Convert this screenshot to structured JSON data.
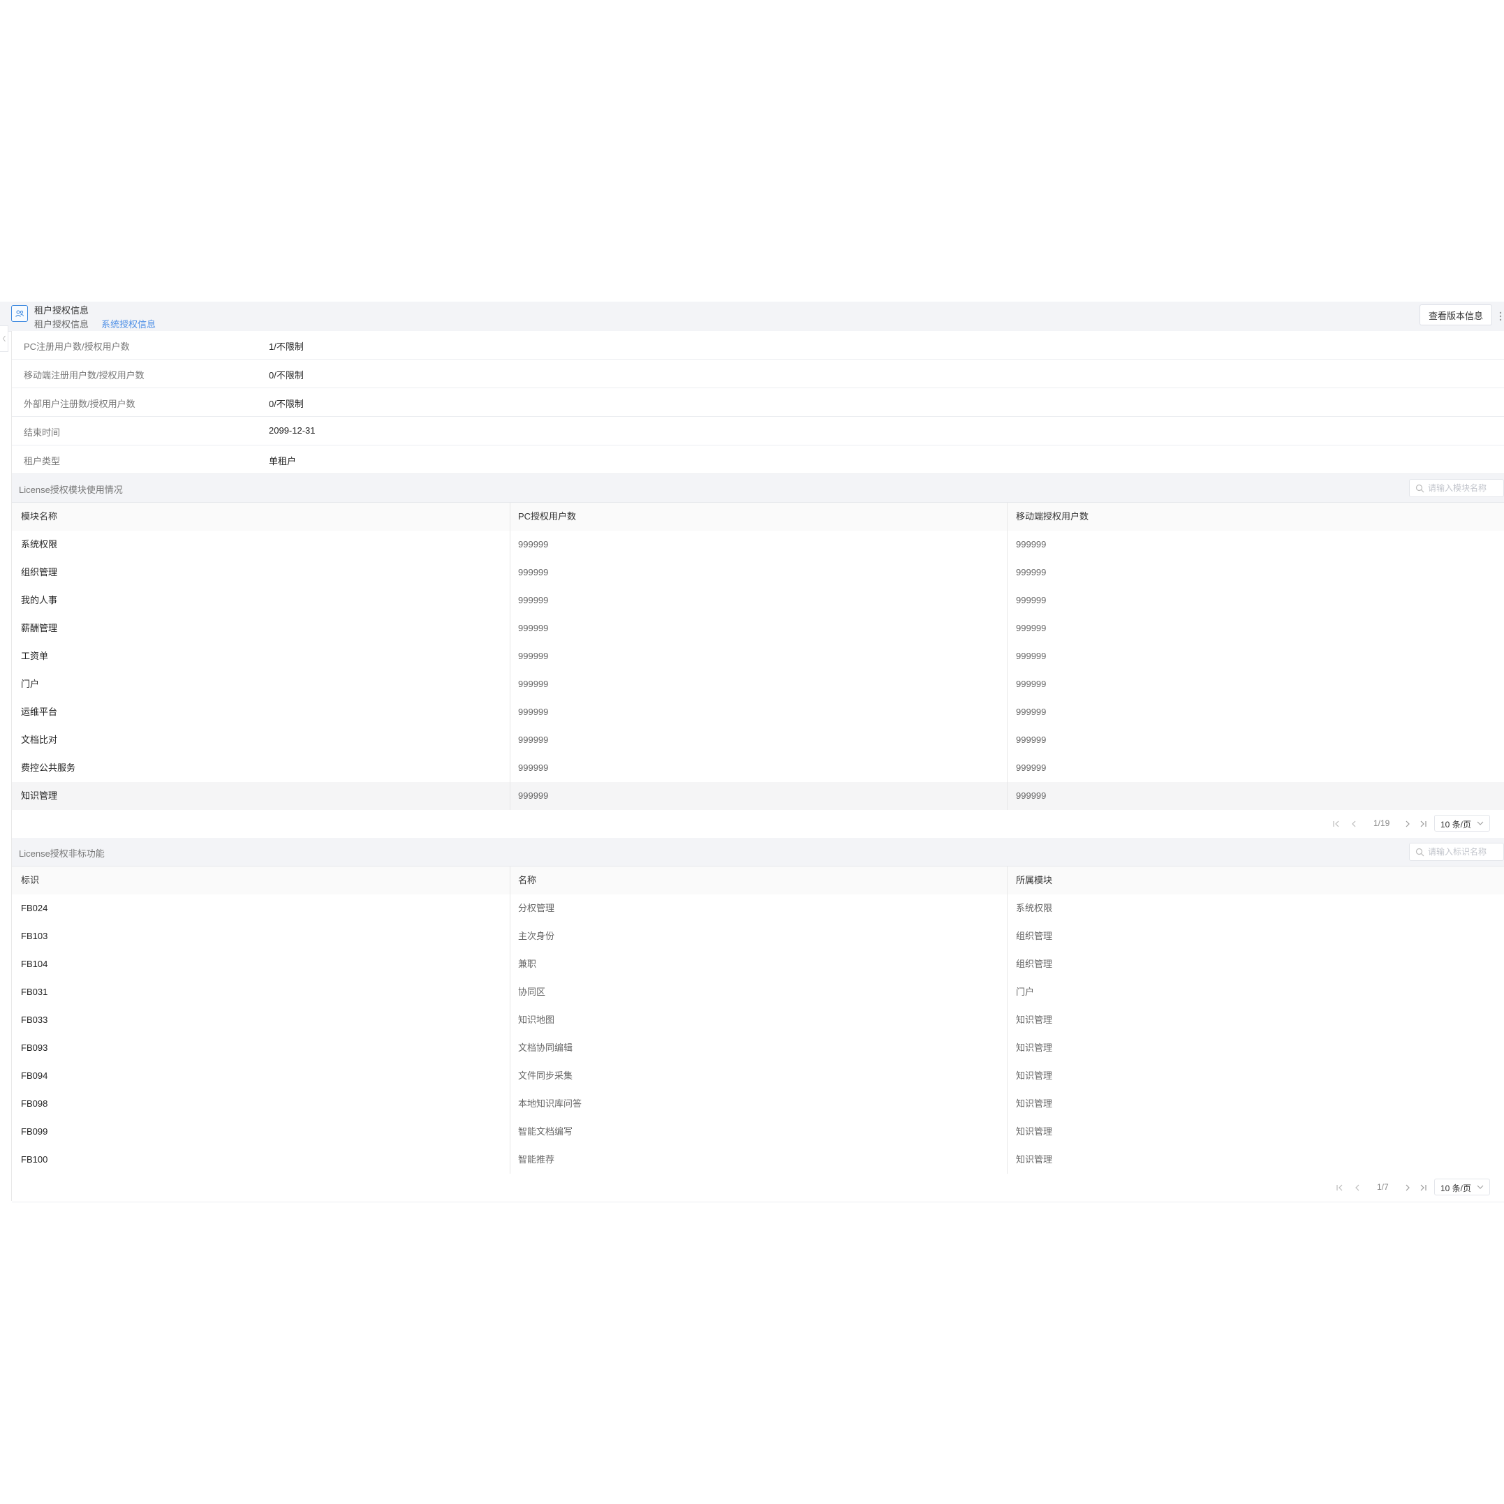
{
  "header": {
    "title": "租户授权信息",
    "tabs": [
      {
        "label": "租户授权信息",
        "active": false
      },
      {
        "label": "系统授权信息",
        "active": true
      }
    ],
    "version_button": "查看版本信息"
  },
  "info_rows": [
    {
      "label": "PC注册用户数/授权用户数",
      "value": "1/不限制"
    },
    {
      "label": "移动端注册用户数/授权用户数",
      "value": "0/不限制"
    },
    {
      "label": "外部用户注册数/授权用户数",
      "value": "0/不限制"
    },
    {
      "label": "结束时间",
      "value": "2099-12-31"
    },
    {
      "label": "租户类型",
      "value": "单租户"
    }
  ],
  "modules_section": {
    "title": "License授权模块使用情况",
    "search_placeholder": "请输入模块名称",
    "columns": [
      "模块名称",
      "PC授权用户数",
      "移动端授权用户数"
    ],
    "rows": [
      [
        "系统权限",
        "999999",
        "999999"
      ],
      [
        "组织管理",
        "999999",
        "999999"
      ],
      [
        "我的人事",
        "999999",
        "999999"
      ],
      [
        "薪酬管理",
        "999999",
        "999999"
      ],
      [
        "工资单",
        "999999",
        "999999"
      ],
      [
        "门户",
        "999999",
        "999999"
      ],
      [
        "运维平台",
        "999999",
        "999999"
      ],
      [
        "文档比对",
        "999999",
        "999999"
      ],
      [
        "费控公共服务",
        "999999",
        "999999"
      ],
      [
        "知识管理",
        "999999",
        "999999"
      ]
    ],
    "pagination": {
      "page": "1/19",
      "page_size": "10 条/页"
    }
  },
  "features_section": {
    "title": "License授权非标功能",
    "search_placeholder": "请输入标识名称",
    "columns": [
      "标识",
      "名称",
      "所属模块"
    ],
    "rows": [
      [
        "FB024",
        "分权管理",
        "系统权限"
      ],
      [
        "FB103",
        "主次身份",
        "组织管理"
      ],
      [
        "FB104",
        "兼职",
        "组织管理"
      ],
      [
        "FB031",
        "协同区",
        "门户"
      ],
      [
        "FB033",
        "知识地图",
        "知识管理"
      ],
      [
        "FB093",
        "文档协同编辑",
        "知识管理"
      ],
      [
        "FB094",
        "文件同步采集",
        "知识管理"
      ],
      [
        "FB098",
        "本地知识库问答",
        "知识管理"
      ],
      [
        "FB099",
        "智能文档编写",
        "知识管理"
      ],
      [
        "FB100",
        "智能推荐",
        "知识管理"
      ]
    ],
    "pagination": {
      "page": "1/7",
      "page_size": "10 条/页"
    }
  },
  "colors": {
    "accent": "#4c8ee6",
    "header_bg": "#f3f4f7",
    "border": "#e8e8e8"
  }
}
